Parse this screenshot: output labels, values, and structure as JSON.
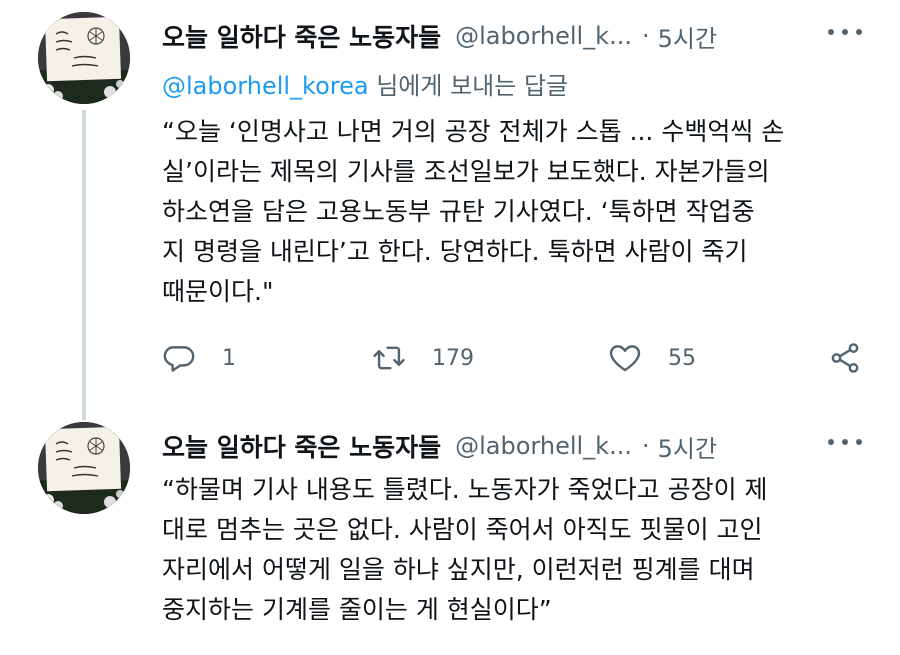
{
  "tweets": [
    {
      "author_name": "오늘 일하다 죽은 노동자들",
      "handle": "@laborhell_k...",
      "separator": "·",
      "time": "5시간",
      "reply_to": {
        "mention": "@laborhell_korea",
        "suffix": " 님에게 보내는 답글"
      },
      "lines": [
        "“오늘 ‘인명사고 나면 거의 공장 전체가 스톱 ... 수백억씩 손",
        "실’이라는 제목의 기사를 조선일보가 보도했다. 자본가들의",
        "하소연을 담은 고용노동부 규탄 기사였다. ‘툭하면 작업중",
        "지 명령을 내린다’고 한다. 당연하다. 툭하면 사람이 죽기",
        "때문이다.\""
      ],
      "stats": {
        "replies": "1",
        "retweets": "179",
        "likes": "55"
      }
    },
    {
      "author_name": "오늘 일하다 죽은 노동자들",
      "handle": "@laborhell_k...",
      "separator": "·",
      "time": "5시간",
      "lines": [
        "“하물며 기사 내용도 틀렸다. 노동자가 죽었다고 공장이 제",
        "대로 멈추는 곳은 없다. 사람이 죽어서 아직도 핏물이 고인",
        "자리에서 어떻게 일을 하냐 싶지만, 이런저런 핑계를 대며",
        "중지하는 기계를 줄이는 게 현실이다”"
      ]
    }
  ],
  "icons": {
    "more": "more-horizontal-icon",
    "reply": "reply-bubble-icon",
    "retweet": "retweet-icon",
    "like": "heart-icon",
    "share": "share-icon"
  },
  "colors": {
    "text": "#0f1419",
    "secondary": "#536471",
    "mention": "#1d9bf0",
    "thread_line": "#cfd9de"
  }
}
